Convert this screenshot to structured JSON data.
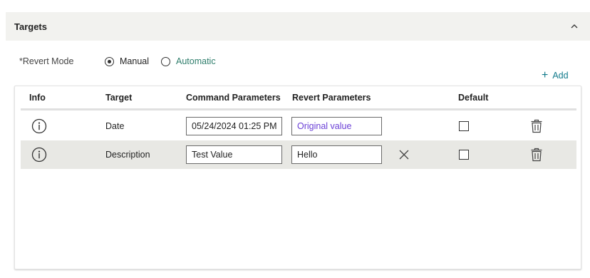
{
  "panel": {
    "title": "Targets"
  },
  "revert_mode": {
    "label": "*Revert Mode",
    "options": [
      {
        "label": "Manual",
        "selected": true
      },
      {
        "label": "Automatic",
        "selected": false
      }
    ]
  },
  "add_button": {
    "label": "Add",
    "icon": "plus-icon"
  },
  "table": {
    "columns": [
      "Info",
      "Target",
      "Command Parameters",
      "Revert Parameters",
      "Default"
    ],
    "rows": [
      {
        "info_icon": "info-icon",
        "target": "Date",
        "command_value": "05/24/2024 01:25 PM",
        "revert_placeholder": "Original value",
        "revert_value": "",
        "default_checked": false,
        "delete_icon": "trash-icon"
      },
      {
        "info_icon": "info-icon",
        "target": "Description",
        "command_value": "Test Value",
        "revert_placeholder": "",
        "revert_value": "Hello",
        "clear_icon": "close-icon",
        "default_checked": false,
        "delete_icon": "trash-icon"
      }
    ]
  },
  "colors": {
    "header_bg": "#f2f2ef",
    "accent": "#117a8b",
    "automatic_text": "#2e7d6b",
    "placeholder_text": "#6a3fd6",
    "selected_row_bg": "#e8e8e4"
  }
}
